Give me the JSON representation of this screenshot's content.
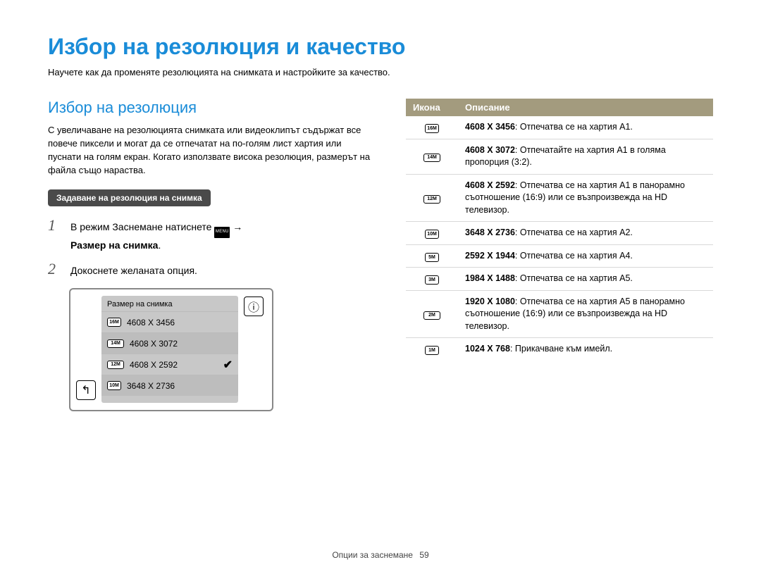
{
  "page_title": "Избор на резолюция и качество",
  "page_intro": "Научете как да променяте резолюцията на снимката и настройките за качество.",
  "section_title": "Избор на резолюция",
  "paragraph": "С увеличаване на резолюцията снимката или видеоклипът съдържат все повече пиксели и могат да се отпечатат на по-голям лист хартия или пуснати на голям екран. Когато използвате висока резолюция, размерът на файла също нараства.",
  "subsection_pill": "Задаване на резолюция на снимка",
  "steps": {
    "1": {
      "num": "1",
      "pre": "В режим Заснемане натиснете ",
      "menu_label": "MENU",
      "arrow": "→",
      "post_bold": "Размер на снимка",
      "post_tail": "."
    },
    "2": {
      "num": "2",
      "text": "Докоснете желаната опция."
    }
  },
  "camera": {
    "list_title": "Размер на снимка",
    "back_glyph": "↰",
    "info_glyph": "ⓘ",
    "rows": [
      {
        "icon": "16M",
        "icon_class": "",
        "text": "4608 X 3456",
        "checked": false
      },
      {
        "icon": "14M",
        "icon_class": "wide",
        "text": "4608 X 3072",
        "checked": false
      },
      {
        "icon": "12M",
        "icon_class": "wide",
        "text": "4608 X 2592",
        "checked": true
      },
      {
        "icon": "10M",
        "icon_class": "",
        "text": "3648 X 2736",
        "checked": false
      }
    ],
    "check_glyph": "✔"
  },
  "table": {
    "head_icon": "Икона",
    "head_desc": "Описание",
    "rows": [
      {
        "icon": "16M",
        "icon_class": "",
        "bold": "4608 X 3456",
        "desc": ": Отпечатва се на хартия A1."
      },
      {
        "icon": "14M",
        "icon_class": "wide",
        "bold": "4608 X 3072",
        "desc": ": Отпечатайте на хартия A1 в голяма пропорция (3:2)."
      },
      {
        "icon": "12M",
        "icon_class": "wide",
        "bold": "4608 X 2592",
        "desc": ": Отпечатва се на хартия A1 в панорамно съотношение (16:9) или се възпроизвежда на HD телевизор."
      },
      {
        "icon": "10M",
        "icon_class": "",
        "bold": "3648 X 2736",
        "desc": ": Отпечатва се на хартия A2."
      },
      {
        "icon": "5M",
        "icon_class": "",
        "bold": "2592 X 1944",
        "desc": ": Отпечатва се на хартия A4."
      },
      {
        "icon": "3M",
        "icon_class": "",
        "bold": "1984 X 1488",
        "desc": ": Отпечатва се на хартия A5."
      },
      {
        "icon": "2M",
        "icon_class": "wide",
        "bold": "1920 X 1080",
        "desc": ": Отпечатва се на хартия A5 в панорамно съотношение (16:9) или се възпроизвежда на HD телевизор."
      },
      {
        "icon": "1M",
        "icon_class": "",
        "bold": "1024 X 768",
        "desc": ": Прикачване към имейл."
      }
    ]
  },
  "footer": {
    "label": "Опции за заснемане",
    "page": "59"
  }
}
